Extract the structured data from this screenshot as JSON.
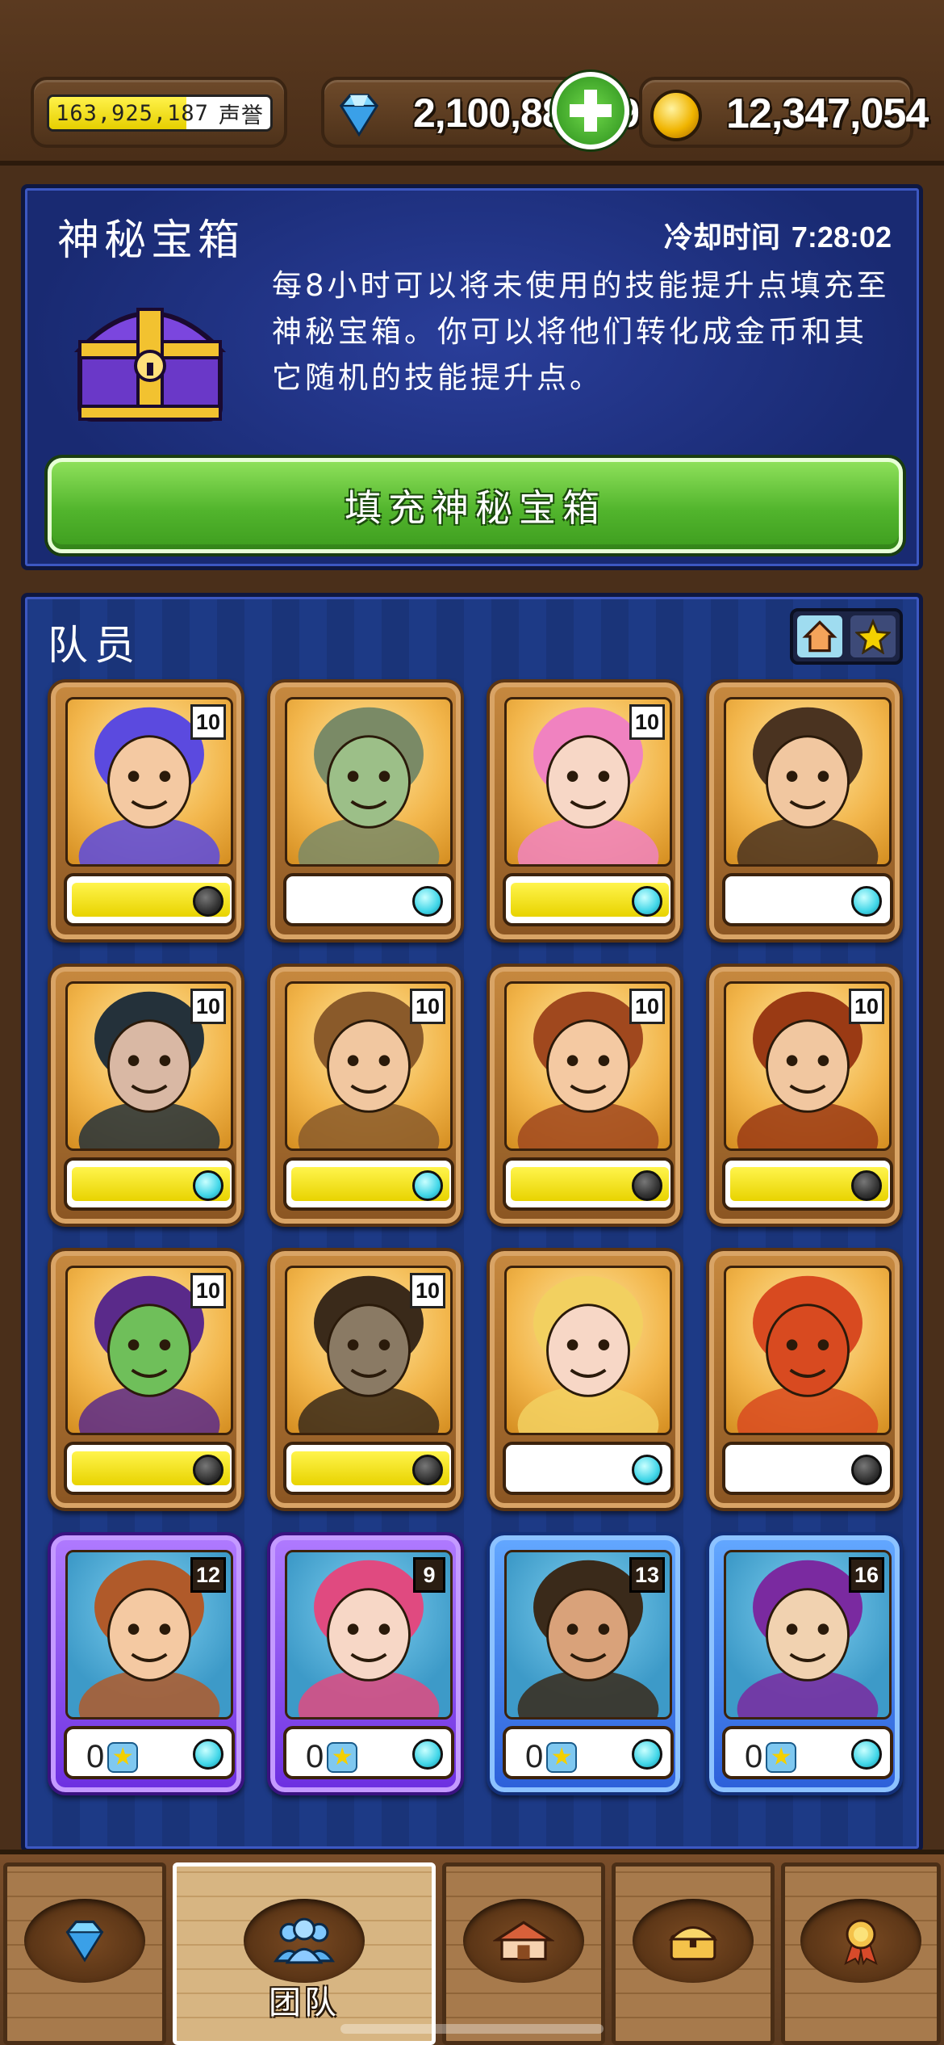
{
  "header": {
    "reputation": {
      "value": "163,925,187",
      "label": "声誉",
      "fill": 0.62
    },
    "gems": {
      "value": "2,100,881,297",
      "icon": "diamond-icon"
    },
    "gold": {
      "value": "12,347,054",
      "icon": "gold-coin-icon"
    }
  },
  "chest": {
    "title": "神秘宝箱",
    "cooldown_label": "冷却时间",
    "cooldown_time": "7:28:02",
    "description": "每8小时可以将未使用的技能提升点填充至神秘宝箱。你可以将他们转化成金币和其它随机的技能提升点。",
    "button_label": "填充神秘宝箱",
    "icon": "treasure-chest-icon"
  },
  "team": {
    "title": "队员",
    "filters": [
      {
        "icon": "home-icon",
        "active": true
      },
      {
        "icon": "star-icon",
        "active": false
      }
    ],
    "members": [
      {
        "level": "10",
        "fill": 1.0,
        "dot": "dark",
        "tier": "common"
      },
      {
        "level": "",
        "fill": 0.0,
        "dot": "cyan",
        "tier": "common"
      },
      {
        "level": "10",
        "fill": 1.0,
        "dot": "cyan",
        "tier": "common"
      },
      {
        "level": "",
        "fill": 0.0,
        "dot": "cyan",
        "tier": "common"
      },
      {
        "level": "10",
        "fill": 1.0,
        "dot": "cyan",
        "tier": "common"
      },
      {
        "level": "10",
        "fill": 1.0,
        "dot": "cyan",
        "tier": "common"
      },
      {
        "level": "10",
        "fill": 1.0,
        "dot": "dark",
        "tier": "common"
      },
      {
        "level": "10",
        "fill": 1.0,
        "dot": "dark",
        "tier": "common"
      },
      {
        "level": "10",
        "fill": 1.0,
        "dot": "dark",
        "tier": "common"
      },
      {
        "level": "10",
        "fill": 1.0,
        "dot": "dark",
        "tier": "common"
      },
      {
        "level": "",
        "fill": 0.0,
        "dot": "cyan",
        "tier": "common"
      },
      {
        "level": "",
        "fill": 0.0,
        "dot": "dark",
        "tier": "common"
      },
      {
        "level": "12",
        "stars": "0",
        "dot": "cyan",
        "tier": "epic"
      },
      {
        "level": "9",
        "stars": "0",
        "dot": "cyan",
        "tier": "epic"
      },
      {
        "level": "13",
        "stars": "0",
        "dot": "cyan",
        "tier": "rare"
      },
      {
        "level": "16",
        "stars": "0",
        "dot": "cyan",
        "tier": "rare"
      }
    ]
  },
  "nav": {
    "items": [
      {
        "name": "gems",
        "icon": "diamond-icon",
        "label": ""
      },
      {
        "name": "team",
        "icon": "team-icon",
        "label": "团队",
        "active": true
      },
      {
        "name": "buildings",
        "icon": "house-icon",
        "label": ""
      },
      {
        "name": "chest",
        "icon": "chest-icon",
        "label": ""
      },
      {
        "name": "achievements",
        "icon": "medal-icon",
        "label": ""
      }
    ]
  }
}
